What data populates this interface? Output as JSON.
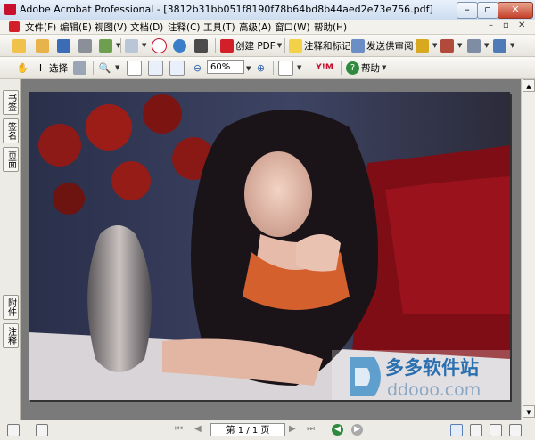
{
  "window": {
    "title": "Adobe Acrobat Professional - [3812b31bb051f8190f78b64bd8b44aed2e73e756.pdf]",
    "min_label": "–",
    "max_label": "▫",
    "close_label": "✕"
  },
  "menu": {
    "items": [
      "文件(F)",
      "编辑(E)",
      "视图(V)",
      "文档(D)",
      "注释(C)",
      "工具(T)",
      "高级(A)",
      "窗口(W)",
      "帮助(H)"
    ],
    "mdi_min": "–",
    "mdi_restore": "▫",
    "mdi_close": "✕"
  },
  "toolbar1": {
    "create_pdf": "创建 PDF",
    "comment_markup": "注释和标记",
    "send_review": "发送供审阅"
  },
  "toolbar2": {
    "select": "选择",
    "zoom_value": "60%",
    "help": "帮助"
  },
  "nav_tabs": {
    "bookmarks": "书签",
    "signatures": "签名",
    "pages": "页面",
    "attachments": "附件",
    "comments": "注释"
  },
  "status": {
    "page_indicator": "第 1 / 1 页"
  },
  "watermark": {
    "brand": "多多软件站",
    "domain": "ddooo.com"
  },
  "colors": {
    "accent_red": "#c8102e",
    "titlebar_blue": "#cddcf0"
  }
}
